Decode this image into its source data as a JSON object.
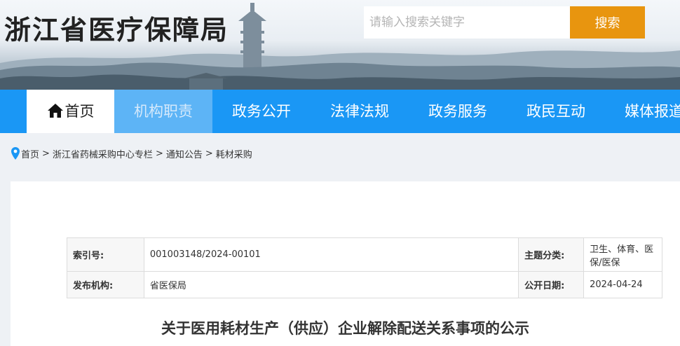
{
  "header": {
    "site_title": "浙江省医疗保障局",
    "search_placeholder": "请输入搜索关键字",
    "search_button": "搜索"
  },
  "nav": {
    "home": "首页",
    "items": [
      "机构职责",
      "政务公开",
      "法律法规",
      "政务服务",
      "政民互动",
      "媒体报道"
    ],
    "active_index": 0
  },
  "breadcrumb": [
    "首页",
    "浙江省药械采购中心专栏",
    "通知公告",
    "耗材采购"
  ],
  "meta": {
    "index_label": "索引号:",
    "index_value": "001003148/2024-00101",
    "topic_label": "主题分类:",
    "topic_value": "卫生、体育、医保/医保",
    "publisher_label": "发布机构:",
    "publisher_value": "省医保局",
    "date_label": "公开日期:",
    "date_value": "2024-04-24"
  },
  "article": {
    "title": "关于医用耗材生产（供应）企业解除配送关系事项的公示"
  },
  "colors": {
    "nav_bg": "#1a97f5",
    "nav_active_bg": "#5db4f6",
    "search_button_bg": "#e8950f",
    "breadcrumb_pin": "#1a97f5"
  }
}
